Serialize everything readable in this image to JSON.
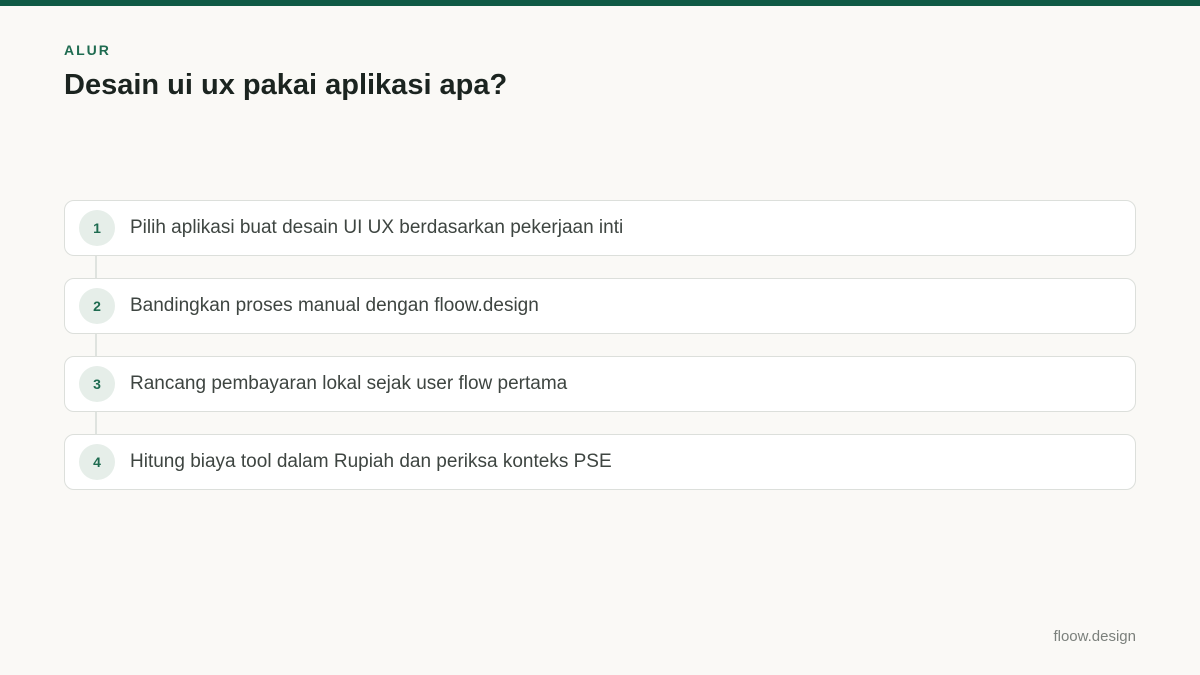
{
  "colors": {
    "accent": "#0f5a45",
    "eyebrow": "#1e6b50",
    "background": "#faf9f6"
  },
  "header": {
    "eyebrow": "ALUR",
    "title": "Desain ui ux pakai aplikasi apa?"
  },
  "steps": [
    {
      "number": "1",
      "text": "Pilih aplikasi buat desain UI UX berdasarkan pekerjaan inti"
    },
    {
      "number": "2",
      "text": "Bandingkan proses manual dengan floow.design"
    },
    {
      "number": "3",
      "text": "Rancang pembayaran lokal sejak user flow pertama"
    },
    {
      "number": "4",
      "text": "Hitung biaya tool dalam Rupiah dan periksa konteks PSE"
    }
  ],
  "footer": {
    "brand": "floow.design"
  }
}
